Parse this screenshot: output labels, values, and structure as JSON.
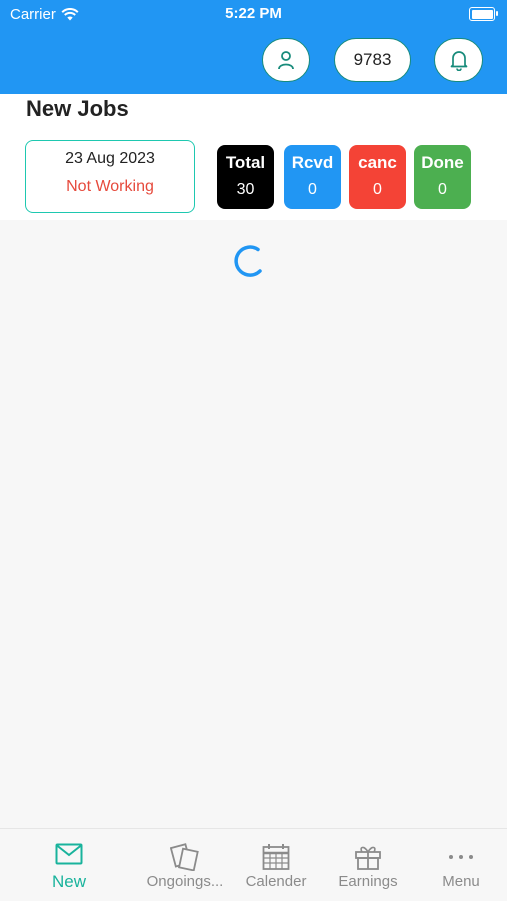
{
  "status_bar": {
    "carrier": "Carrier",
    "time": "5:22 PM"
  },
  "header": {
    "count": "9783"
  },
  "page": {
    "title": "New Jobs"
  },
  "date_card": {
    "date": "23 Aug 2023",
    "status": "Not Working"
  },
  "stats": [
    {
      "label": "Total",
      "value": "30",
      "color": "#000000"
    },
    {
      "label": "Rcvd",
      "value": "0",
      "color": "#2196f3"
    },
    {
      "label": "canc",
      "value": "0",
      "color": "#f44336"
    },
    {
      "label": "Done",
      "value": "0",
      "color": "#4caf50"
    }
  ],
  "tabs": [
    {
      "label": "New",
      "icon": "mail-icon",
      "active": true
    },
    {
      "label": "Ongoings...",
      "icon": "cards-icon",
      "active": false
    },
    {
      "label": "Calender",
      "icon": "calendar-icon",
      "active": false
    },
    {
      "label": "Earnings",
      "icon": "gift-icon",
      "active": false
    },
    {
      "label": "Menu",
      "icon": "more-dots-icon",
      "active": false
    }
  ],
  "colors": {
    "accent": "#2196f3",
    "teal": "#19b39c",
    "danger": "#e64a3c"
  }
}
